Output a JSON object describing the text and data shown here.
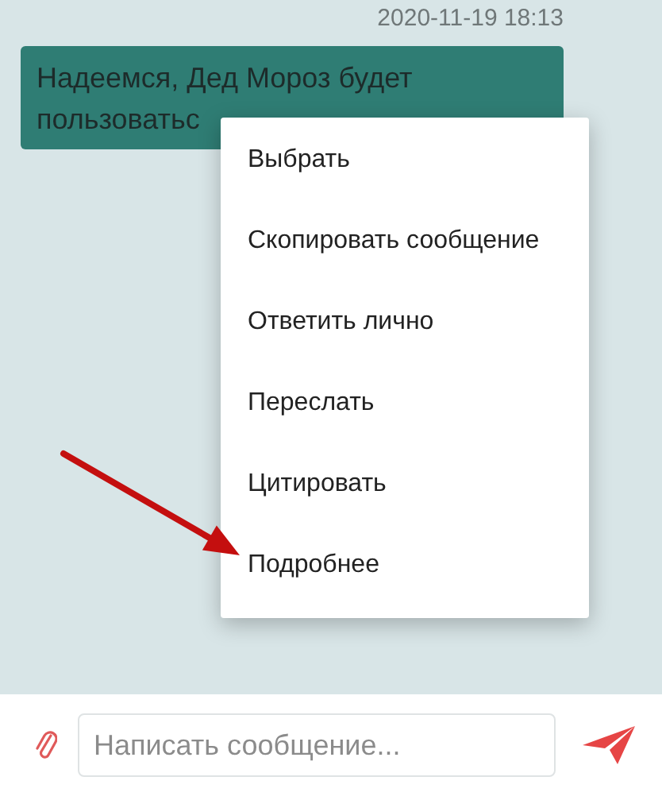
{
  "chat": {
    "messages": [
      {
        "time": "2020-11-19 18:13",
        "text": "Надеемся, Дед Мороз будет пользоватьс"
      }
    ]
  },
  "context_menu": {
    "items": [
      {
        "label": "Выбрать",
        "pointed": false
      },
      {
        "label": "Скопировать сообщение",
        "pointed": false
      },
      {
        "label": "Ответить лично",
        "pointed": false
      },
      {
        "label": "Переслать",
        "pointed": false
      },
      {
        "label": "Цитировать",
        "pointed": false
      },
      {
        "label": "Подробнее",
        "pointed": true
      }
    ]
  },
  "composer": {
    "placeholder": "Написать сообщение..."
  }
}
